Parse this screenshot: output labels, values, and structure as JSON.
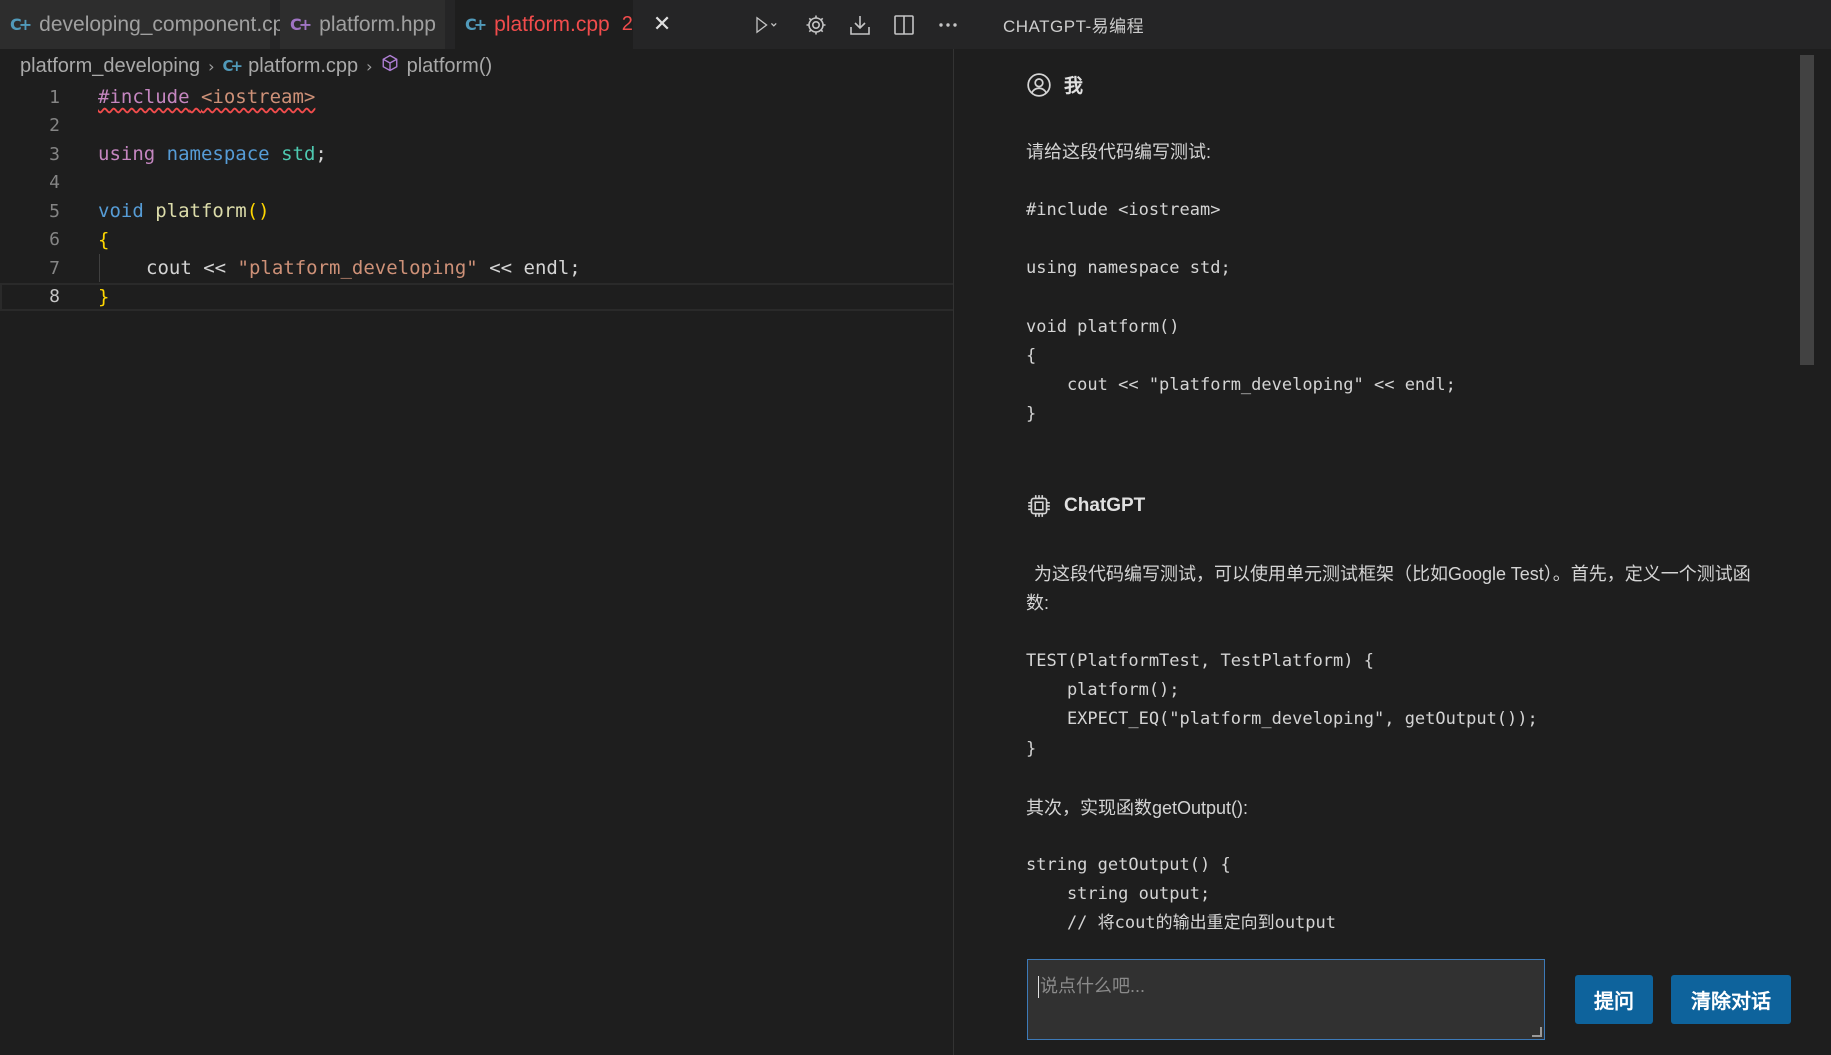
{
  "tabs": [
    {
      "label": "developing_component.cpp",
      "icon": "cpp-file-icon"
    },
    {
      "label": "platform.hpp",
      "icon": "cpp-header-icon"
    },
    {
      "label": "platform.cpp",
      "badge": "2",
      "icon": "cpp-file-icon",
      "active": true
    }
  ],
  "panel_title": "CHATGPT-易编程",
  "breadcrumb": {
    "folder": "platform_developing",
    "file": "platform.cpp",
    "symbol": "platform()"
  },
  "editor": {
    "line_numbers": [
      "1",
      "2",
      "3",
      "4",
      "5",
      "6",
      "7",
      "8"
    ],
    "line1": {
      "directive": "#include",
      "header": "<iostream>"
    },
    "line3": {
      "using": "using",
      "namespace": "namespace",
      "std": "std",
      "semi": ";"
    },
    "line5": {
      "void": "void",
      "name": "platform",
      "parens": "()"
    },
    "line6": {
      "brace": "{"
    },
    "line7": {
      "cout": "cout",
      "op1": " << ",
      "str": "\"platform_developing\"",
      "op2": " << endl;"
    },
    "line8": {
      "brace": "}"
    }
  },
  "chat": {
    "user_name": "我",
    "user_prompt": "请给这段代码编写测试:",
    "user_code": [
      "#include <iostream>",
      "",
      "using namespace std;",
      "",
      "void platform()",
      "{",
      "    cout << \"platform_developing\" << endl;",
      "}"
    ],
    "bot_name": "ChatGPT",
    "bot_intro": "为这段代码编写测试，可以使用单元测试框架（比如Google Test）。首先，定义一个测试函数:",
    "bot_code1": [
      "TEST(PlatformTest, TestPlatform) {",
      "    platform();",
      "    EXPECT_EQ(\"platform_developing\", getOutput());",
      "}"
    ],
    "bot_text2": "其次，实现函数getOutput():",
    "bot_code2": [
      "string getOutput() {",
      "    string output;",
      "    // 将cout的输出重定向到output"
    ]
  },
  "input": {
    "placeholder": "说点什么吧..."
  },
  "buttons": {
    "ask": "提问",
    "clear": "清除对话"
  }
}
